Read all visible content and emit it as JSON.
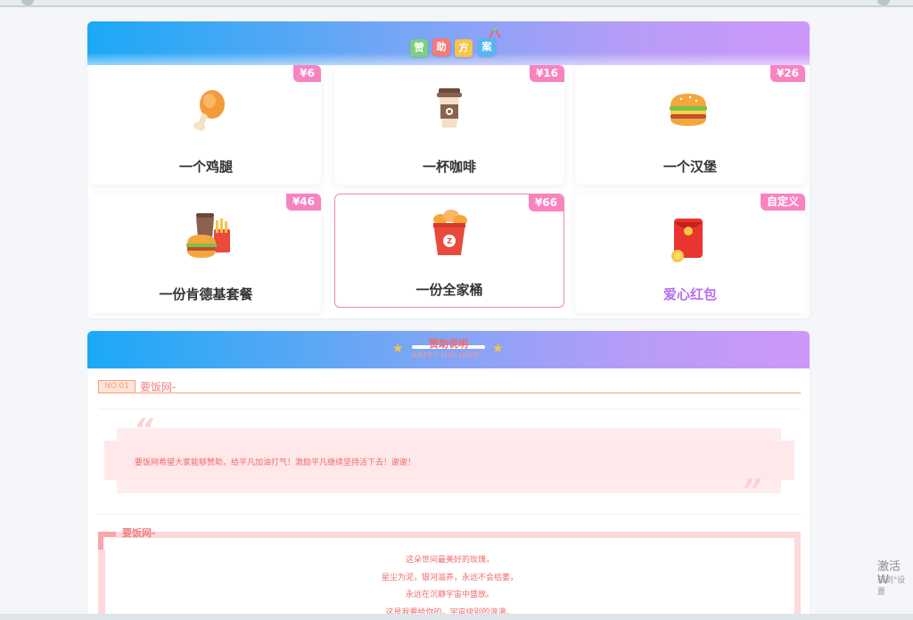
{
  "sponsor_plan": {
    "title_chars": [
      "赞",
      "助",
      "方",
      "案"
    ],
    "title_colors": [
      "#7ccf7e",
      "#f47a7a",
      "#f7c54a",
      "#57b5f3"
    ],
    "options": [
      {
        "price": "¥6",
        "name": "一个鸡腿",
        "icon": "chicken-leg-icon"
      },
      {
        "price": "¥16",
        "name": "一杯咖啡",
        "icon": "coffee-cup-icon"
      },
      {
        "price": "¥26",
        "name": "一个汉堡",
        "icon": "hamburger-icon"
      },
      {
        "price": "¥46",
        "name": "一份肯德基套餐",
        "icon": "combo-meal-icon"
      },
      {
        "price": "¥66",
        "name": "一份全家桶",
        "icon": "chicken-bucket-icon"
      },
      {
        "price": "自定义",
        "name": "爱心红包",
        "icon": "red-envelope-icon"
      }
    ],
    "selected_index": 4
  },
  "sponsor_info": {
    "title": "赞助说明",
    "subtitle": "HAPPY HOLIDAY",
    "badge": "NO.01",
    "section1_label": "要饭网-",
    "quote": "要饭网希望大家能够赞助，给平凡加油打气！激励平凡继续坚持活下去！谢谢！",
    "section2_label": "要饭网-",
    "poem": [
      "这朵世间最美好的玫瑰，",
      "星尘为泥，银河滋养，永远不会枯萎，",
      "永远在沉静宇宙中盛放。",
      "这是我要给你的，宇宙级别的浪漫。"
    ]
  },
  "watermark": {
    "line1": "激活 W",
    "line2": "转到\"设置"
  },
  "colors": {
    "header_gradient_start": "#1aa9f6",
    "header_gradient_end": "#cd97fb",
    "price_badge": "#f983c1",
    "accent_red": "#f06a6a",
    "selected_border": "#f08aa7"
  }
}
